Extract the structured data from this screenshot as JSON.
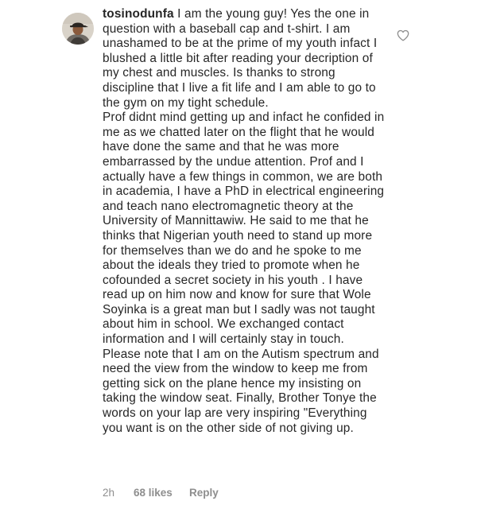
{
  "comment": {
    "username": "tosinodunfa",
    "paragraphs": [
      " I am the young guy! Yes the one in question with a baseball cap and t-shirt. I am unashamed  to be at the prime of my youth infact I blushed a little bit after reading your decription of my chest and muscles. Is thanks to strong discipline that I live a fit life and I am able to go to the gym on my tight schedule.",
      "Prof didnt mind getting up and infact he confided in me as we chatted later on the flight that he would have done the same and that he was more embarrassed by the undue attention.  Prof and I actually have a few things in common, we are both in academia, I have a PhD in electrical engineering and teach nano electromagnetic theory at the University of Mannittawiw. He said to me that he thinks that Nigerian youth need to stand up more for themselves than we do and he spoke to me about the ideals they tried to promote when he cofounded a secret society in his youth . I have read up on him now and know for sure that Wole Soyinka is a great man but I sadly was not taught about him in school. We exchanged contact information and I will certainly stay in touch.",
      "Please note that I am on the Autism spectrum and need the view from the window to keep me from getting sick on the plane hence my insisting on taking the window seat.  Finally, Brother Tonye the words on your lap are very inspiring \"Everything you want is on the other side of not giving up."
    ],
    "time": "2h",
    "likes": "68 likes",
    "reply_label": "Reply"
  },
  "icons": {
    "avatar": "profile-photo",
    "like": "heart-outline-icon"
  },
  "colors": {
    "text": "#262626",
    "muted": "#8e8e8e",
    "icon": "#8e8e8e"
  }
}
